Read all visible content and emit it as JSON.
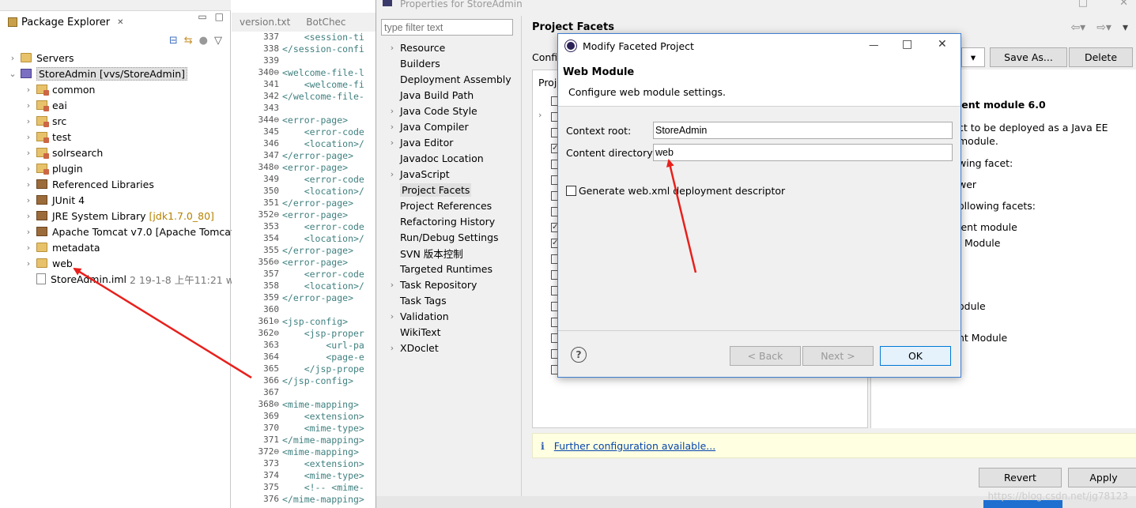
{
  "package_explorer": {
    "tab_label": "Package Explorer",
    "close_glyph": "✕",
    "tree": [
      {
        "label": "Servers",
        "icon": "folder-icon",
        "expanded": false
      },
      {
        "label": "StoreAdmin [vvs/StoreAdmin]",
        "icon": "project-icon",
        "expanded": true,
        "selected": true
      },
      {
        "label": "common",
        "icon": "package-folder-icon"
      },
      {
        "label": "eai",
        "icon": "package-folder-icon"
      },
      {
        "label": "src",
        "icon": "package-folder-icon"
      },
      {
        "label": "test",
        "icon": "package-folder-icon"
      },
      {
        "label": "solrsearch",
        "icon": "package-folder-icon"
      },
      {
        "label": "plugin",
        "icon": "package-folder-icon"
      },
      {
        "label": "Referenced Libraries",
        "icon": "library-icon"
      },
      {
        "label": "JUnit 4",
        "icon": "library-icon"
      },
      {
        "label": "JRE System Library",
        "extra": "[jdk1.7.0_80]",
        "icon": "library-icon"
      },
      {
        "label": "Apache Tomcat v7.0 [Apache Tomcat v",
        "icon": "library-icon"
      },
      {
        "label": "metadata",
        "icon": "folder-icon"
      },
      {
        "label": "web",
        "icon": "folder-icon"
      },
      {
        "label": "StoreAdmin.iml",
        "extra": "2  19-1-8 上午11:21  w",
        "icon": "file-icon"
      }
    ]
  },
  "editor": {
    "tabs": [
      "version.txt",
      "BotChec"
    ],
    "lines": [
      {
        "n": "337",
        "code": "    <session-ti"
      },
      {
        "n": "338",
        "code": "</session-confi"
      },
      {
        "n": "339",
        "code": ""
      },
      {
        "n": "340⊖",
        "code": "<welcome-file-l"
      },
      {
        "n": "341",
        "code": "    <welcome-fi"
      },
      {
        "n": "342",
        "code": "</welcome-file-"
      },
      {
        "n": "343",
        "code": ""
      },
      {
        "n": "344⊖",
        "code": "<error-page>"
      },
      {
        "n": "345",
        "code": "    <error-code"
      },
      {
        "n": "346",
        "code": "    <location>/"
      },
      {
        "n": "347",
        "code": "</error-page>"
      },
      {
        "n": "348⊖",
        "code": "<error-page>"
      },
      {
        "n": "349",
        "code": "    <error-code"
      },
      {
        "n": "350",
        "code": "    <location>/"
      },
      {
        "n": "351",
        "code": "</error-page>"
      },
      {
        "n": "352⊖",
        "code": "<error-page>"
      },
      {
        "n": "353",
        "code": "    <error-code"
      },
      {
        "n": "354",
        "code": "    <location>/"
      },
      {
        "n": "355",
        "code": "</error-page>"
      },
      {
        "n": "356⊖",
        "code": "<error-page>"
      },
      {
        "n": "357",
        "code": "    <error-code"
      },
      {
        "n": "358",
        "code": "    <location>/"
      },
      {
        "n": "359",
        "code": "</error-page>"
      },
      {
        "n": "360",
        "code": ""
      },
      {
        "n": "361⊖",
        "code": "<jsp-config>"
      },
      {
        "n": "362⊖",
        "code": "    <jsp-proper"
      },
      {
        "n": "363",
        "code": "        <url-pa"
      },
      {
        "n": "364",
        "code": "        <page-e"
      },
      {
        "n": "365",
        "code": "    </jsp-prope"
      },
      {
        "n": "366",
        "code": "</jsp-config>"
      },
      {
        "n": "367",
        "code": ""
      },
      {
        "n": "368⊖",
        "code": "<mime-mapping>"
      },
      {
        "n": "369",
        "code": "    <extension>"
      },
      {
        "n": "370",
        "code": "    <mime-type>"
      },
      {
        "n": "371",
        "code": "</mime-mapping>"
      },
      {
        "n": "372⊖",
        "code": "<mime-mapping>"
      },
      {
        "n": "373",
        "code": "    <extension>"
      },
      {
        "n": "374",
        "code": "    <mime-type>"
      },
      {
        "n": "375",
        "code": "    <!-- <mime-"
      },
      {
        "n": "376",
        "code": "</mime-mapping>"
      }
    ]
  },
  "properties": {
    "window_title": "Properties for StoreAdmin",
    "filter_placeholder": "type filter text",
    "nav": [
      {
        "label": "Resource",
        "expandable": true
      },
      {
        "label": "Builders",
        "expandable": false
      },
      {
        "label": "Deployment Assembly",
        "expandable": false
      },
      {
        "label": "Java Build Path",
        "expandable": false
      },
      {
        "label": "Java Code Style",
        "expandable": true
      },
      {
        "label": "Java Compiler",
        "expandable": true
      },
      {
        "label": "Java Editor",
        "expandable": true
      },
      {
        "label": "Javadoc Location",
        "expandable": false
      },
      {
        "label": "JavaScript",
        "expandable": true
      },
      {
        "label": "Project Facets",
        "expandable": false,
        "selected": true
      },
      {
        "label": "Project References",
        "expandable": false
      },
      {
        "label": "Refactoring History",
        "expandable": false
      },
      {
        "label": "Run/Debug Settings",
        "expandable": false
      },
      {
        "label": "SVN 版本控制",
        "expandable": false
      },
      {
        "label": "Targeted Runtimes",
        "expandable": false
      },
      {
        "label": "Task Repository",
        "expandable": true
      },
      {
        "label": "Task Tags",
        "expandable": false
      },
      {
        "label": "Validation",
        "expandable": true
      },
      {
        "label": "WikiText",
        "expandable": false
      },
      {
        "label": "XDoclet",
        "expandable": true
      }
    ],
    "page_title": "Project Facets",
    "config_label": "Config",
    "proj_label": "Proj",
    "save_as": "Save As...",
    "delete": "Delete",
    "right_panel": {
      "heading": "ient module 6.0",
      "lines": [
        "ct to be deployed as a Java EE",
        "module.",
        "wing facet:",
        "wer",
        "ollowing facets:",
        "ient module",
        "Module",
        "odule",
        "nt Module"
      ]
    },
    "info_link": "Further configuration available...",
    "revert": "Revert",
    "apply": "Apply"
  },
  "modal": {
    "title": "Modify Faceted Project",
    "header_title": "Web Module",
    "header_desc": "Configure web module settings.",
    "context_root_label": "Context root:",
    "context_root_value": "StoreAdmin",
    "content_dir_label": "Content directory:",
    "content_dir_value": "web",
    "generate_label": "Generate web.xml deployment descriptor",
    "generate_checked": false,
    "back": "< Back",
    "next": "Next >",
    "ok": "OK",
    "help_glyph": "?"
  },
  "watermark": "https://blog.csdn.net/jg78123"
}
